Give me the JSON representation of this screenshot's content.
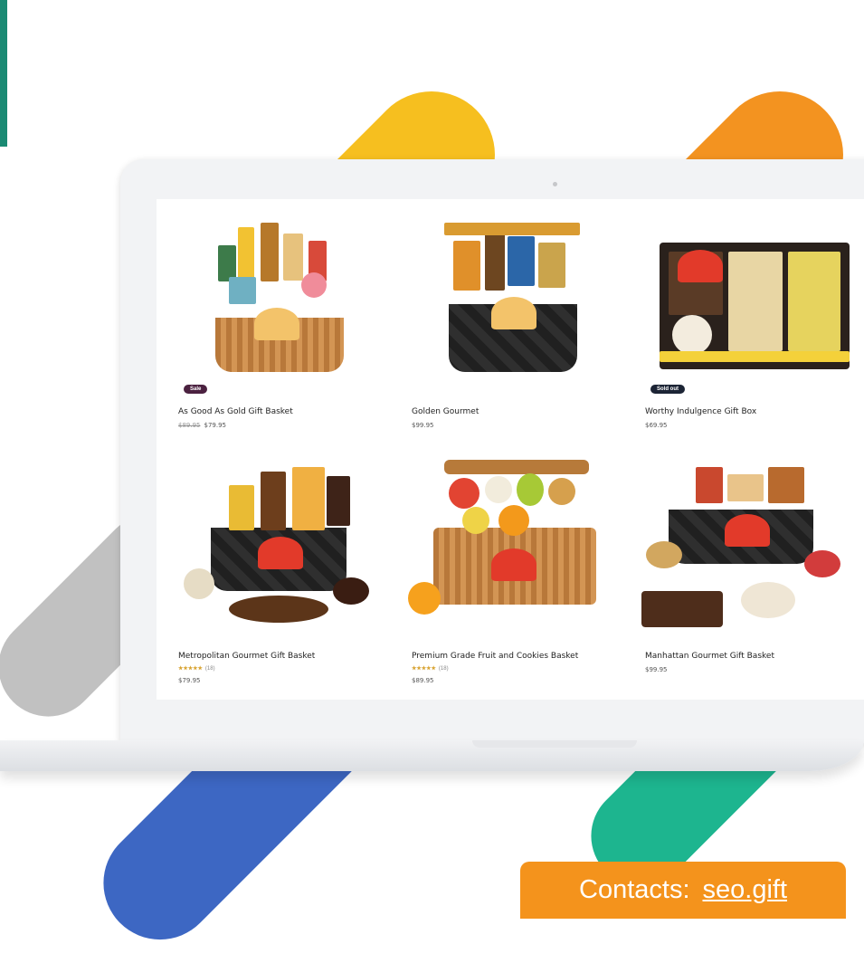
{
  "products": [
    {
      "title": "As Good As Gold Gift Basket",
      "old_price": "$89.95",
      "price": "$79.95",
      "badge": "Sale",
      "rating": null,
      "reviews": null,
      "art": "gold"
    },
    {
      "title": "Golden Gourmet",
      "old_price": null,
      "price": "$99.95",
      "badge": null,
      "rating": null,
      "reviews": null,
      "art": "gourmet"
    },
    {
      "title": "Worthy Indulgence Gift Box",
      "old_price": null,
      "price": "$69.95",
      "badge": "Sold out",
      "rating": null,
      "reviews": null,
      "art": "box"
    },
    {
      "title": "Metropolitan Gourmet Gift Basket",
      "old_price": null,
      "price": "$79.95",
      "badge": null,
      "rating": "★★★★★",
      "reviews": "(18)",
      "art": "metro"
    },
    {
      "title": "Premium Grade Fruit and Cookies Basket",
      "old_price": null,
      "price": "$89.95",
      "badge": null,
      "rating": "★★★★★",
      "reviews": "(18)",
      "art": "fruit"
    },
    {
      "title": "Manhattan Gourmet Gift Basket",
      "old_price": null,
      "price": "$99.95",
      "badge": null,
      "rating": null,
      "reviews": null,
      "art": "manhattan"
    }
  ],
  "cta": {
    "label": "Contacts:",
    "link_text": "seo.gift"
  },
  "colors": {
    "yellow": "#f6bf1f",
    "orange": "#f39320",
    "blue": "#3d67c3",
    "green": "#1db58f",
    "gray": "#c1c1c1",
    "cta": "#f4931c"
  }
}
